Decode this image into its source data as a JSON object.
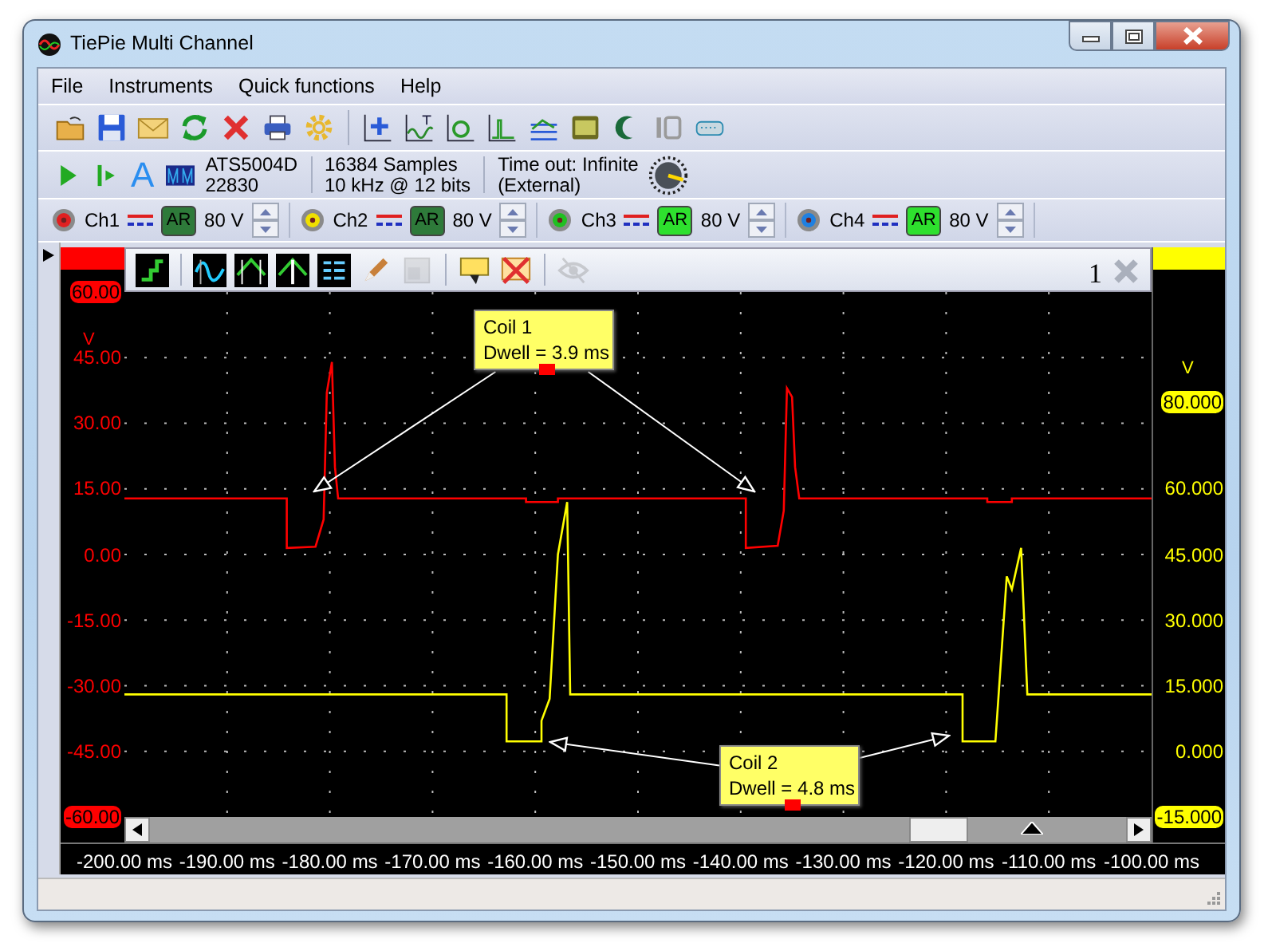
{
  "window": {
    "title": "TiePie Multi Channel"
  },
  "menu": [
    "File",
    "Instruments",
    "Quick functions",
    "Help"
  ],
  "acquisition": {
    "auto_glyph": "A",
    "instrument": "ATS5004D",
    "serial": "22830",
    "samples": "16384 Samples",
    "rate": "10 kHz @ 12 bits",
    "timeout": "Time out: Infinite",
    "source": "(External)"
  },
  "channels": [
    {
      "label": "Ch1",
      "color": "#e02020",
      "auto_range_label": "AR",
      "auto_range": false,
      "range": "80 V"
    },
    {
      "label": "Ch2",
      "color": "#f0e000",
      "auto_range_label": "AR",
      "auto_range": false,
      "range": "80 V"
    },
    {
      "label": "Ch3",
      "color": "#20c020",
      "auto_range_label": "AR",
      "auto_range": true,
      "range": "80 V"
    },
    {
      "label": "Ch4",
      "color": "#2080e0",
      "auto_range_label": "AR",
      "auto_range": true,
      "range": "80 V"
    }
  ],
  "scope": {
    "number": "1",
    "tools": [
      {
        "disabled": false
      },
      {
        "disabled": false
      },
      {
        "disabled": false
      },
      {
        "disabled": false
      },
      {
        "disabled": false
      },
      {
        "disabled": false
      },
      {
        "disabled": true
      },
      {
        "disabled": false
      },
      {
        "disabled": false
      },
      {
        "disabled": true
      }
    ],
    "chart_data": {
      "type": "line",
      "ylabel": "V",
      "y2label": "V",
      "xlim": [
        -200,
        -100
      ],
      "ylim": [
        -60,
        60
      ],
      "y2lim": [
        -15,
        105
      ],
      "xticks": [
        {
          "value": -200,
          "label": "-200.00 ms"
        },
        {
          "value": -190,
          "label": "-190.00 ms"
        },
        {
          "value": -180,
          "label": "-180.00 ms"
        },
        {
          "value": -170,
          "label": "-170.00 ms"
        },
        {
          "value": -160,
          "label": "-160.00 ms"
        },
        {
          "value": -150,
          "label": "-150.00 ms"
        },
        {
          "value": -140,
          "label": "-140.00 ms"
        },
        {
          "value": -130,
          "label": "-130.00 ms"
        },
        {
          "value": -120,
          "label": "-120.00 ms"
        },
        {
          "value": -110,
          "label": "-110.00 ms"
        },
        {
          "value": -100,
          "label": "-100.00 ms"
        }
      ],
      "yticks": [
        {
          "value": 60,
          "label": "60.00"
        },
        {
          "value": 45,
          "label": "45.00"
        },
        {
          "value": 30,
          "label": "30.00"
        },
        {
          "value": 15,
          "label": "15.00"
        },
        {
          "value": 0,
          "label": "0.00"
        },
        {
          "value": -15,
          "label": "-15.00"
        },
        {
          "value": -30,
          "label": "-30.00"
        },
        {
          "value": -45,
          "label": "-45.00"
        },
        {
          "value": -60,
          "label": "-60.00"
        }
      ],
      "y2ticks": [
        {
          "value": 80,
          "label": "80.000"
        },
        {
          "value": 60,
          "label": "60.000"
        },
        {
          "value": 45,
          "label": "45.000"
        },
        {
          "value": 30,
          "label": "30.000"
        },
        {
          "value": 15,
          "label": "15.000"
        },
        {
          "value": 0,
          "label": "0.000"
        },
        {
          "value": -15,
          "label": "-15.000"
        }
      ],
      "x": [
        -200,
        -184.2,
        -184.2,
        -181.4,
        -180.6,
        -180.3,
        -179.8,
        -179.5,
        -179.2,
        -162.8,
        -162.8,
        -160.9,
        -160.9,
        -159.4,
        -159.4,
        -158.6,
        -157.8,
        -157.8,
        -156.9,
        -156.6,
        -139.5,
        -139.5,
        -136.4,
        -135.8,
        -135.5,
        -135.0,
        -134.7,
        -134.3,
        -118.4,
        -118.4,
        -116.0,
        -116.0,
        -115.2,
        -114.1,
        -113.6,
        -113.6,
        -112.7,
        -112.1,
        -100
      ],
      "series": [
        {
          "color": "#ff0000",
          "axis": "y",
          "values": [
            12.8,
            12.8,
            1.5,
            1.8,
            8,
            37,
            44,
            20,
            12.8,
            12.8,
            12.8,
            12.8,
            12.0,
            12.0,
            12.0,
            12.0,
            12.0,
            12.8,
            12.8,
            12.8,
            12.8,
            1.5,
            2,
            10,
            38,
            36,
            20,
            12.8,
            12.8,
            12.8,
            12.8,
            12.0,
            12.0,
            12.0,
            12.0,
            12.8,
            12.8,
            12.8,
            12.8
          ]
        },
        {
          "color": "#ffff00",
          "axis": "y2",
          "values": [
            13,
            13,
            13,
            13,
            13,
            13,
            13,
            13,
            13,
            13,
            2.3,
            2.3,
            2.3,
            2.3,
            7,
            12,
            45,
            45,
            57,
            13,
            13,
            13,
            13,
            13,
            13,
            13,
            13,
            13,
            13,
            2.3,
            2.3,
            2.3,
            2.3,
            40,
            37,
            37,
            46.5,
            13,
            13
          ]
        }
      ],
      "annotations": [
        "Coil 1\nDwell = 3.9 ms",
        "Coil 2\nDwell = 4.8 ms"
      ],
      "grid": true
    }
  }
}
